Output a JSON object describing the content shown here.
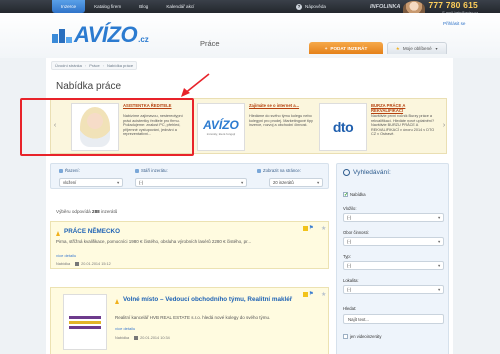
{
  "topbar": {
    "nav": [
      "Inzerce",
      "Katalog firem",
      "Blog",
      "Kalendář akcí"
    ],
    "help": "Nápověda",
    "infoline": {
      "label": "INFOLINKA",
      "phone": "777 780 615",
      "email": "E-mail: help@avizo.cz"
    }
  },
  "header": {
    "logo_text": "AVÍZO",
    "logo_suffix": ".cz",
    "section": "Práce",
    "login": "Přihlásit se",
    "add_button": "PODAT INZERÁT",
    "saved_button": "Moje oblíbené"
  },
  "breadcrumb": [
    "Úvodní stránka",
    "Práce",
    "Nabídka práce"
  ],
  "page_title": "Nabídka práce",
  "colors": {
    "accent": "#2c7bd0",
    "orange": "#e5811a",
    "highlight": "#e8232a",
    "listing_bg": "#fffbe0"
  },
  "carousel": [
    {
      "title": "ASISTENTKA ŘEDITELE",
      "text": "Nabízíme zajímavou, nestereotypní práci acistentky ředitele pro firmu. Požadujeme: znalost PC, přehled, příjemné vystupování, jednání a reprezentativní...",
      "logo": "photo"
    },
    {
      "title": "Zajímáte se o internet a...",
      "text": "Hledáme do svého týmu kolegu nebo kolegyni pro prodej. Marketingové tipy inzerce, rozvoj a obchodní činnost.",
      "logo": "AVÍZO",
      "logo_caption": "inzeráty, které fungují"
    },
    {
      "title": "BURZA PRÁCE A REKVALIFIKACÍ",
      "text": "Navštivte první ročník Burzy práce a rekvalifikací. Hledáte nové uplatnění? Navštivte BURZU PRÁCE A REKVALIFIKACÍ v únoru 2014 v DTO CZ v Ostravě.",
      "logo": "dto"
    }
  ],
  "filters": {
    "sort": {
      "label": "Řazení:",
      "value": "vložení"
    },
    "age": {
      "label": "Stáří inzerátu:",
      "value": "(-)"
    },
    "per_page": {
      "label": "Zobrazit na stránce:",
      "value": "20 inzerátů"
    }
  },
  "result": {
    "prefix": "Výběru odpovídá",
    "count": "288",
    "suffix": "inzerátů"
  },
  "listings": [
    {
      "title": "PRÁCE NĚMECKO",
      "desc": "Pirna, střížná kvalifikace, pomocníci 1980 € čistého, obsluha výrobních lasérů 2280 € čistého, pr...",
      "more": "více detailu",
      "location": "Nabídka",
      "date": "20.01.2014 15:12"
    },
    {
      "title": "Volné místo – Vedoucí obchodního týmu, Realitní makléř",
      "desc": "Realitní kancelář HVB REAL ESTATE s.r.o. hledá nové kolegy do svého týmu.",
      "more": "více detailu",
      "location": "Nabídka",
      "date": "20.01.2014 10:34"
    }
  ],
  "search": {
    "title": "Vyhledávání:",
    "checkbox": "Nabídka",
    "fields": [
      {
        "label": "Vložilo:",
        "value": "(-)"
      },
      {
        "label": "Obor činnosti:",
        "value": "(-)"
      },
      {
        "label": "Typ:",
        "value": "(-)"
      },
      {
        "label": "Lokalita:",
        "value": "(-)"
      }
    ],
    "keyword_label": "Hledat:",
    "keyword_value": "Najít text...",
    "video_label": "jen videoinzeráty"
  },
  "icons": {
    "help": "help-icon",
    "search": "magnifier-icon",
    "star": "star-icon",
    "note": "note-icon",
    "pin": "pin-icon",
    "calendar": "calendar-icon",
    "warning": "warning-triangle-icon"
  }
}
